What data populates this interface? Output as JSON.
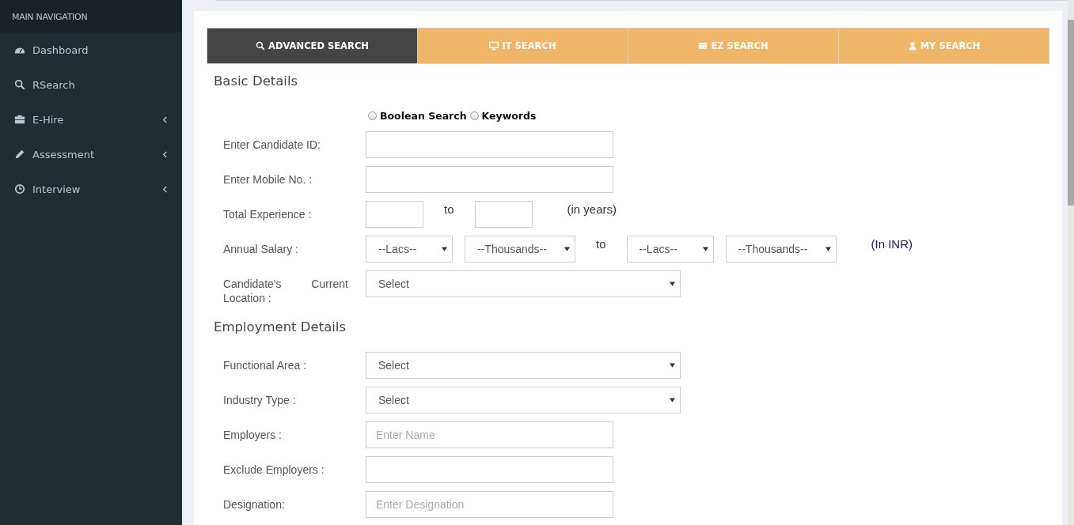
{
  "sidebar": {
    "header": "MAIN NAVIGATION",
    "items": [
      {
        "label": "Dashboard",
        "has_submenu": false
      },
      {
        "label": "RSearch",
        "has_submenu": false
      },
      {
        "label": "E-Hire",
        "has_submenu": true
      },
      {
        "label": "Assessment",
        "has_submenu": true
      },
      {
        "label": "Interview",
        "has_submenu": true
      }
    ]
  },
  "tabs": [
    {
      "label": "ADVANCED SEARCH",
      "selected": true
    },
    {
      "label": "IT SEARCH",
      "selected": false
    },
    {
      "label": "EZ SEARCH",
      "selected": false
    },
    {
      "label": "MY SEARCH",
      "selected": false
    }
  ],
  "sections": [
    {
      "title": "Basic Details",
      "search_modes": [
        {
          "label": "Boolean Search",
          "selected": false
        },
        {
          "label": "Keywords",
          "selected": false
        }
      ],
      "rows": [
        {
          "label": "Enter Candidate ID:",
          "parts": [
            {
              "kind": "input"
            }
          ]
        },
        {
          "label": "Enter Mobile No. :",
          "parts": [
            {
              "kind": "input"
            }
          ]
        },
        {
          "label": "Total Experience :",
          "parts": [
            {
              "kind": "short-input"
            },
            {
              "kind": "word",
              "text": "to"
            },
            {
              "kind": "short-input"
            },
            {
              "kind": "note",
              "text": "(in years)"
            }
          ]
        },
        {
          "label": "Annual Salary :",
          "parts": [
            {
              "kind": "short-select",
              "value": "--Lacs--"
            },
            {
              "kind": "mid-select",
              "value": "--Thousands--"
            },
            {
              "kind": "word",
              "text": "to"
            },
            {
              "kind": "short-select",
              "value": "--Lacs--"
            },
            {
              "kind": "mid-select",
              "value": "--Thousands--"
            },
            {
              "kind": "note",
              "text": "(In INR)"
            }
          ]
        },
        {
          "label": "Candidate's Current Location :",
          "parts": [
            {
              "kind": "select",
              "value": "Select"
            }
          ]
        }
      ]
    },
    {
      "title": "Employment Details",
      "rows": [
        {
          "label": "Functional Area :",
          "parts": [
            {
              "kind": "select",
              "value": "Select"
            }
          ]
        },
        {
          "label": "Industry Type :",
          "parts": [
            {
              "kind": "select",
              "value": "Select"
            }
          ]
        },
        {
          "label": "Employers :",
          "parts": [
            {
              "kind": "input",
              "placeholder": "Enter Name"
            }
          ]
        },
        {
          "label": "Exclude Employers :",
          "parts": [
            {
              "kind": "input"
            }
          ]
        },
        {
          "label": "Designation:",
          "parts": [
            {
              "kind": "input",
              "placeholder": "Enter Designation"
            }
          ]
        }
      ]
    }
  ]
}
